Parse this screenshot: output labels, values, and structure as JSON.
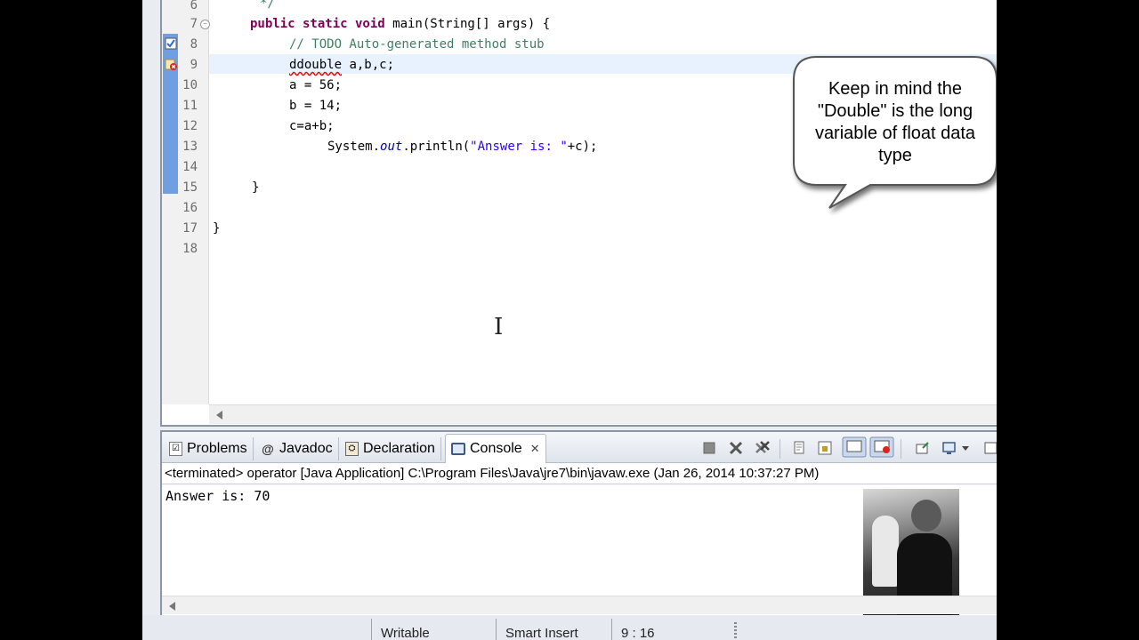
{
  "editor": {
    "line_numbers": [
      "6",
      "7",
      "8",
      "9",
      "10",
      "11",
      "12",
      "13",
      "14",
      "15",
      "16",
      "17",
      "18"
    ],
    "code": {
      "l6": "*/",
      "l7_kw": "public static void",
      "l7_rest": " main(String[] args) {",
      "l8": "// TODO Auto-generated method stub",
      "l9_err": "ddouble",
      "l9_rest": " a,b,c;",
      "l10": "a = 56;",
      "l11": "b = 14;",
      "l12": "c=a+b;",
      "l13_a": "System.",
      "l13_b": "out",
      "l13_c": ".println(",
      "l13_d": "\"Answer is: \"",
      "l13_e": "+c);",
      "l15": "}",
      "l17": "}"
    },
    "colors": {
      "keyword": "#7f0055",
      "comment": "#3f7f5f",
      "string": "#2a00ff",
      "field": "#0000c0"
    }
  },
  "callout": {
    "text": "Keep in mind the \"Double\" is the long variable of float data type"
  },
  "console_view": {
    "tabs": [
      {
        "label": "Problems",
        "icon": "problems-icon"
      },
      {
        "label": "Javadoc",
        "icon": "at-icon"
      },
      {
        "label": "Declaration",
        "icon": "declaration-icon"
      },
      {
        "label": "Console",
        "icon": "console-icon",
        "active": true
      }
    ],
    "close_glyph": "✕",
    "launch_status": "<terminated> operator [Java Application] C:\\Program Files\\Java\\jre7\\bin\\javaw.exe (Jan 26, 2014 10:37:27 PM)",
    "output": "Answer is: 70"
  },
  "statusbar": {
    "writable": "Writable",
    "insert_mode": "Smart Insert",
    "position": "9 : 16"
  }
}
